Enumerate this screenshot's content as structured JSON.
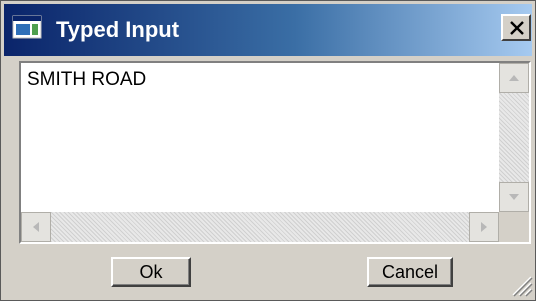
{
  "window": {
    "title": "Typed Input",
    "colors": {
      "titlebar_start": "#0a246a",
      "titlebar_end": "#a6caf0",
      "face": "#d4d0c8"
    }
  },
  "titlebar": {
    "app_icon": "window-app-icon",
    "close_icon": "close-icon"
  },
  "text_area": {
    "value": "SMITH ROAD"
  },
  "scrollbars": {
    "vertical": {
      "up_icon": "arrow-up-icon",
      "down_icon": "arrow-down-icon"
    },
    "horizontal": {
      "left_icon": "arrow-left-icon",
      "right_icon": "arrow-right-icon"
    }
  },
  "buttons": {
    "ok_label": "Ok",
    "cancel_label": "Cancel"
  },
  "resize_grip_icon": "resize-grip-icon"
}
